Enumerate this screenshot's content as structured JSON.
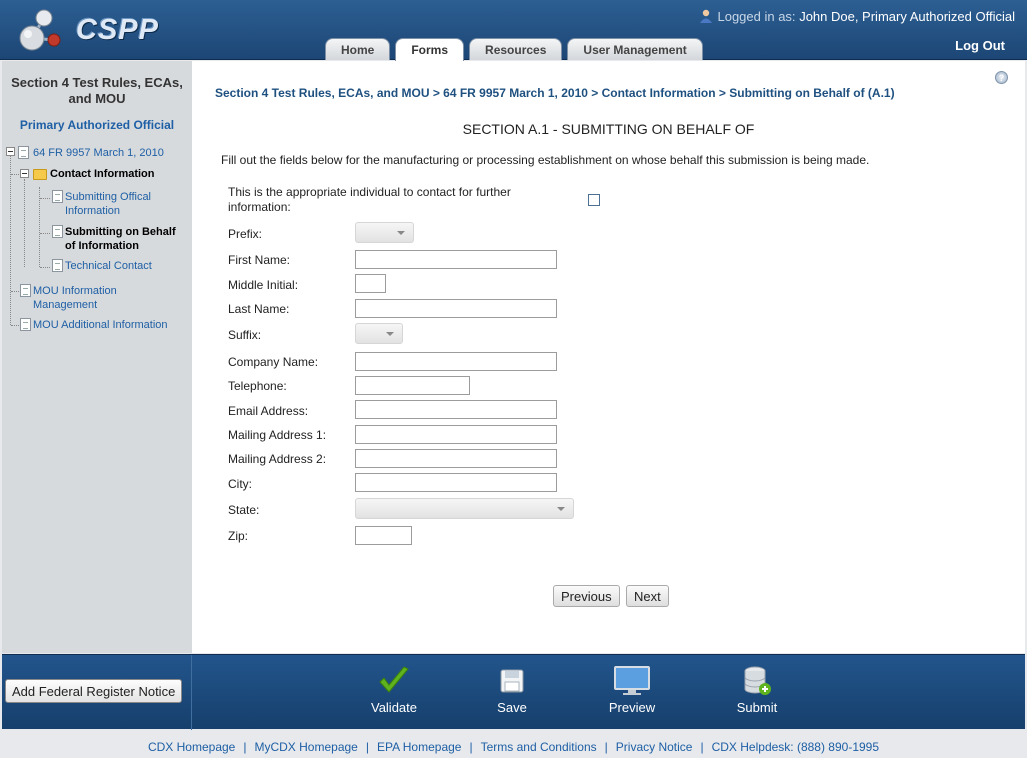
{
  "header": {
    "logo_text": "CSPP",
    "logged_prefix": "Logged in as:",
    "logged_user": "John Doe, Primary Authorized Official",
    "logout": "Log Out",
    "tabs": [
      "Home",
      "Forms",
      "Resources",
      "User Management"
    ],
    "active_tab": "Forms"
  },
  "sidebar": {
    "title": "Section 4 Test Rules, ECAs, and MOU",
    "role": "Primary Authorized Official",
    "tree": {
      "root": "64 FR 9957 March 1, 2010",
      "contact": "Contact Information",
      "submitting_official": "Submitting Offical Information",
      "submitting_behalf": "Submitting on Behalf of Information",
      "technical_contact": "Technical Contact",
      "mou_info": "MOU Information Management",
      "mou_additional": "MOU Additional Information"
    }
  },
  "main": {
    "breadcrumb": "Section 4 Test Rules, ECAs, and MOU > 64 FR 9957 March 1, 2010 > Contact Information > Submitting on Behalf of (A.1)",
    "section_title": "SECTION A.1 - SUBMITTING ON BEHALF OF",
    "instructions": "Fill out the fields below for the manufacturing or processing establishment on whose behalf this submission is being made.",
    "contact_question": "This is the appropriate individual to contact for further information:",
    "contact_checked": false,
    "fields": {
      "prefix": "Prefix:",
      "first_name": "First Name:",
      "middle_initial": "Middle Initial:",
      "last_name": "Last Name:",
      "suffix": "Suffix:",
      "company_name": "Company Name:",
      "telephone": "Telephone:",
      "email": "Email Address:",
      "mailing1": "Mailing Address 1:",
      "mailing2": "Mailing Address 2:",
      "city": "City:",
      "state": "State:",
      "zip": "Zip:"
    },
    "previous": "Previous",
    "next": "Next"
  },
  "footer_bar": {
    "add_notice": "Add Federal Register Notice",
    "validate": "Validate",
    "save": "Save",
    "preview": "Preview",
    "submit": "Submit"
  },
  "footer_links": [
    "CDX Homepage",
    "MyCDX Homepage",
    "EPA Homepage",
    "Terms and Conditions",
    "Privacy Notice",
    "CDX Helpdesk: (888) 890-1995"
  ],
  "colors": {
    "header": "#1c4675",
    "link": "#1e5fa5",
    "sidebar": "#d7dadd",
    "validate_check": "#5fb31e"
  }
}
